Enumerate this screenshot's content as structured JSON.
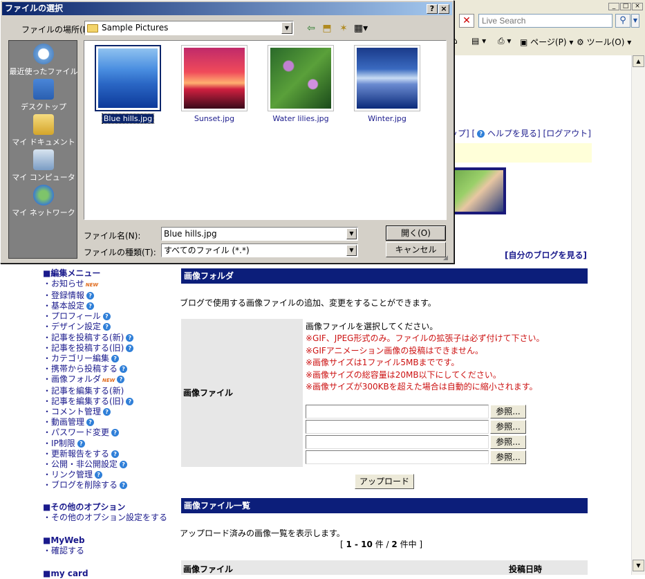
{
  "browser": {
    "search_placeholder": "Live Search",
    "toolbar": {
      "page_label": "ページ(P)",
      "tools_label": "ツール(O)"
    },
    "window_buttons": [
      "_",
      "□",
      "×"
    ]
  },
  "page": {
    "header_links": [
      "ップ]",
      "[",
      "ヘルプを見る]",
      "[ログアウト]"
    ],
    "my_blog_link": "[自分のブログを見る]",
    "sidebar": {
      "edit_menu_title": "■編集メニュー",
      "edit_items": [
        {
          "label": "・お知らせ",
          "new": true,
          "help": false
        },
        {
          "label": "・登録情報",
          "new": false,
          "help": true
        },
        {
          "label": "・基本設定",
          "new": false,
          "help": true
        },
        {
          "label": "・プロフィール",
          "new": false,
          "help": true
        },
        {
          "label": "・デザイン設定",
          "new": false,
          "help": true
        },
        {
          "label": "・記事を投稿する(新)",
          "new": false,
          "help": true
        },
        {
          "label": "・記事を投稿する(旧)",
          "new": false,
          "help": true
        },
        {
          "label": "・カテゴリー編集",
          "new": false,
          "help": true
        },
        {
          "label": "・携帯から投稿する",
          "new": false,
          "help": true
        },
        {
          "label": "・画像フォルダ",
          "new": true,
          "help": true
        },
        {
          "label": "・記事を編集する(新)",
          "new": false,
          "help": false
        },
        {
          "label": "・記事を編集する(旧)",
          "new": false,
          "help": true
        },
        {
          "label": "・コメント管理",
          "new": false,
          "help": true
        },
        {
          "label": "・動画管理",
          "new": false,
          "help": true
        },
        {
          "label": "・パスワード変更",
          "new": false,
          "help": true
        },
        {
          "label": "・IP制限",
          "new": false,
          "help": true
        },
        {
          "label": "・更新報告をする",
          "new": false,
          "help": true
        },
        {
          "label": "・公開・非公開設定",
          "new": false,
          "help": true
        },
        {
          "label": "・リンク管理",
          "new": false,
          "help": true
        },
        {
          "label": "・ブログを削除する",
          "new": false,
          "help": true
        }
      ],
      "new_badge": "NEW",
      "other_title": "■その他のオプション",
      "other_item": "・その他のオプション設定をする",
      "myweb_title": "■MyWeb",
      "myweb_item": "・確認する",
      "mycard_title": "■my card"
    },
    "image_folder": {
      "title": "画像フォルダ",
      "description": "ブログで使用する画像ファイルの追加、変更をすることができます。",
      "field_label": "画像ファイル",
      "instruction": "画像ファイルを選択してください。",
      "notes": [
        "※GIF、JPEG形式のみ。ファイルの拡張子は必ず付けて下さい。",
        "※GIFアニメーション画像の投稿はできません。",
        "※画像サイズは1ファイル5MBまでです。",
        "※画像サイズの総容量は20MB以下にしてください。",
        "※画像サイズが300KBを超えた場合は自動的に縮小されます。"
      ],
      "browse_label": "参照...",
      "upload_label": "アップロード"
    },
    "image_list": {
      "title": "画像ファイル一覧",
      "description": "アップロード済みの画像一覧を表示します。",
      "pager_prefix": "[ ",
      "pager_range": "1 - 10",
      "pager_mid": " 件 / ",
      "pager_total": "2",
      "pager_suffix": " 件中 ]",
      "col_file": "画像ファイル",
      "col_date": "投稿日時"
    }
  },
  "dialog": {
    "title": "ファイルの選択",
    "look_in_label": "ファイルの場所(I):",
    "look_in_value": "Sample Pictures",
    "places": [
      "最近使ったファイル",
      "デスクトップ",
      "マイ ドキュメント",
      "マイ コンピュータ",
      "マイ ネットワーク"
    ],
    "files": [
      {
        "name": "Blue hills.jpg",
        "selected": true
      },
      {
        "name": "Sunset.jpg",
        "selected": false
      },
      {
        "name": "Water lilies.jpg",
        "selected": false
      },
      {
        "name": "Winter.jpg",
        "selected": false
      }
    ],
    "filename_label": "ファイル名(N):",
    "filename_value": "Blue hills.jpg",
    "filetype_label": "ファイルの種類(T):",
    "filetype_value": "すべてのファイル (*.*)",
    "open_label": "開く(O)",
    "cancel_label": "キャンセル",
    "help_button": "?",
    "close_button": "×"
  }
}
